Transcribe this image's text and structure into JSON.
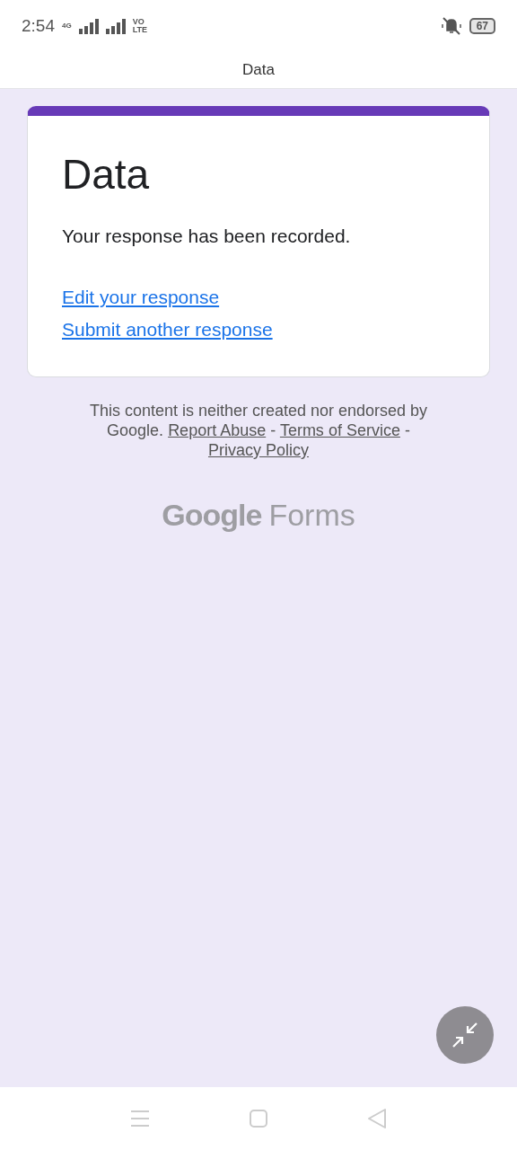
{
  "status_bar": {
    "time": "2:54",
    "network": "4G",
    "volte_top": "VO",
    "volte_bottom": "LTE",
    "battery": "67"
  },
  "app_bar": {
    "title": "Data"
  },
  "form": {
    "title": "Data",
    "message": "Your response has been recorded.",
    "links": [
      "Edit your response",
      "Submit another response"
    ]
  },
  "footer": {
    "text": "This content is neither created nor endorsed by Google.",
    "links": [
      "Report Abuse",
      "Terms of Service",
      "Privacy Policy"
    ],
    "separator": "-"
  },
  "logo": {
    "brand": "Google",
    "product": "Forms"
  }
}
